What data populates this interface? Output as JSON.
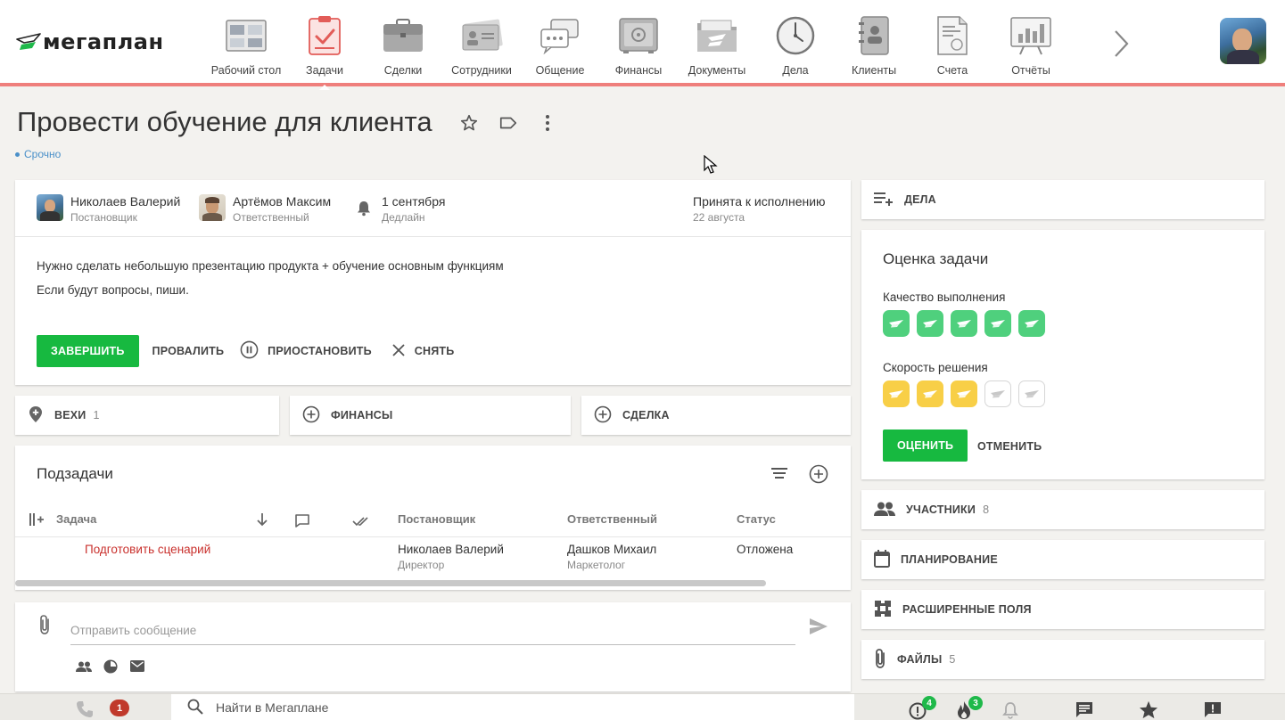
{
  "app": {
    "logo_text": "мегаплан",
    "brand_color": "#1fb94a",
    "accent_red": "#ef7f7c"
  },
  "nav": {
    "items": [
      {
        "label": "Рабочий стол",
        "icon": "dashboard-icon"
      },
      {
        "label": "Задачи",
        "icon": "tasks-icon",
        "active": true
      },
      {
        "label": "Сделки",
        "icon": "briefcase-icon"
      },
      {
        "label": "Сотрудники",
        "icon": "employees-icon"
      },
      {
        "label": "Общение",
        "icon": "chat-icon"
      },
      {
        "label": "Финансы",
        "icon": "safe-icon"
      },
      {
        "label": "Документы",
        "icon": "folder-icon"
      },
      {
        "label": "Дела",
        "icon": "clock-icon"
      },
      {
        "label": "Клиенты",
        "icon": "contacts-book-icon"
      },
      {
        "label": "Счета",
        "icon": "invoice-icon"
      },
      {
        "label": "Отчёты",
        "icon": "reports-icon"
      }
    ]
  },
  "task": {
    "title": "Провести обучение для клиента",
    "tag": "Срочно",
    "owner": {
      "name": "Николаев Валерий",
      "role": "Постановщик"
    },
    "responsible": {
      "name": "Артёмов Максим",
      "role": "Ответственный"
    },
    "deadline": {
      "date": "1 сентября",
      "label": "Дедлайн"
    },
    "status": {
      "text": "Принята к исполнению",
      "date": "22 августа"
    },
    "description": [
      "Нужно сделать небольшую презентацию продукта + обучение основным функциям",
      "Если будут вопросы, пиши."
    ],
    "actions": {
      "complete": "ЗАВЕРШИТЬ",
      "fail": "ПРОВАЛИТЬ",
      "pause": "ПРИОСТАНОВИТЬ",
      "cancel": "СНЯТЬ"
    }
  },
  "blocks": {
    "milestones": {
      "label": "ВЕХИ",
      "count": "1"
    },
    "finance": {
      "label": "ФИНАНСЫ"
    },
    "deal": {
      "label": "СДЕЛКА"
    }
  },
  "subtasks": {
    "title": "Подзадачи",
    "columns": {
      "task": "Задача",
      "owner": "Постановщик",
      "responsible": "Ответственный",
      "status": "Статус"
    },
    "rows": [
      {
        "task": "Подготовить сценарий",
        "owner": "Николаев Валерий",
        "owner_role": "Директор",
        "responsible": "Дашков Михаил",
        "responsible_role": "Маркетолог",
        "status": "Отложена"
      }
    ]
  },
  "message": {
    "placeholder": "Отправить сообщение"
  },
  "side": {
    "affairs": {
      "label": "ДЕЛА"
    },
    "rating": {
      "title": "Оценка задачи",
      "quality_label": "Качество выполнения",
      "quality_value": 5,
      "speed_label": "Скорость решения",
      "speed_value": 3,
      "max": 5,
      "rate_button": "ОЦЕНИТЬ",
      "cancel_button": "ОТМЕНИТЬ"
    },
    "participants": {
      "label": "УЧАСТНИКИ",
      "count": "8"
    },
    "planning": {
      "label": "ПЛАНИРОВАНИЕ"
    },
    "extended_fields": {
      "label": "РАСШИРЕННЫЕ ПОЛЯ"
    },
    "files": {
      "label": "ФАЙЛЫ",
      "count": "5"
    }
  },
  "bottom": {
    "calls_badge": "1",
    "search_placeholder": "Найти в Мегаплане",
    "alerts_badge": "4",
    "hot_badge": "3"
  }
}
